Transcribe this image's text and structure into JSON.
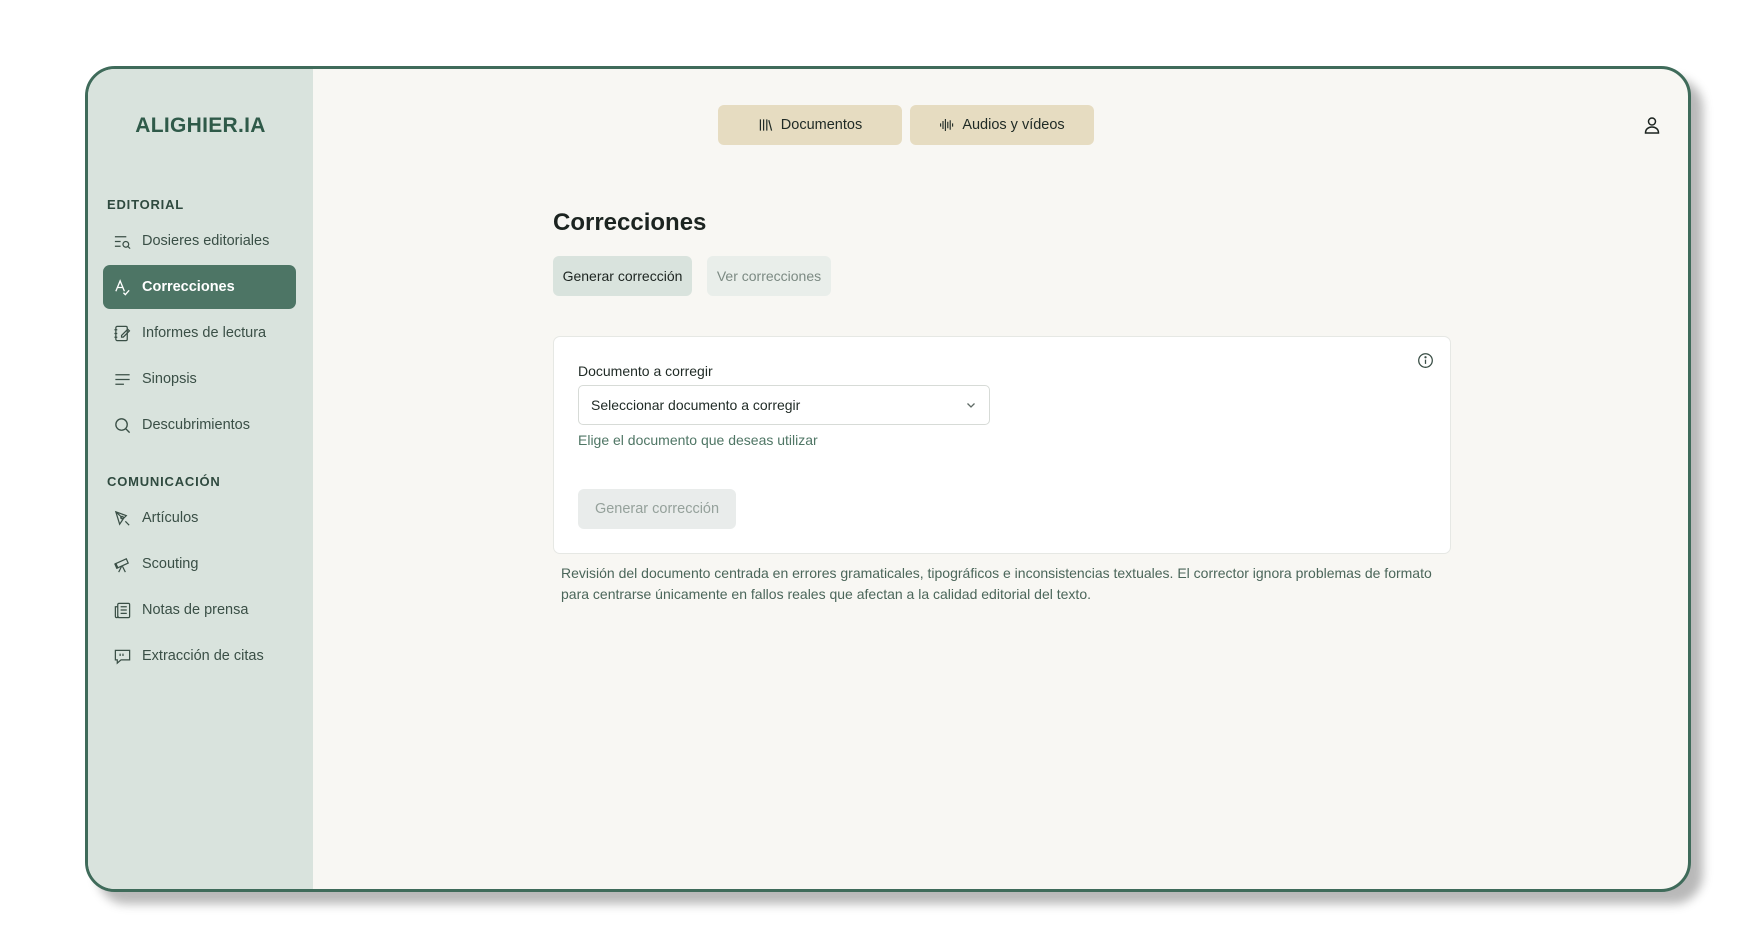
{
  "app": {
    "logo": "ALIGHIER.IA"
  },
  "sidebar": {
    "sections": [
      {
        "title": "EDITORIAL"
      },
      {
        "title": "COMUNICACIÓN"
      }
    ],
    "items": [
      {
        "label": "Dosieres editoriales",
        "icon": "list-search-icon"
      },
      {
        "label": "Correcciones",
        "icon": "spellcheck-icon",
        "active": true
      },
      {
        "label": "Informes de lectura",
        "icon": "notebook-edit-icon"
      },
      {
        "label": "Sinopsis",
        "icon": "align-left-icon"
      },
      {
        "label": "Descubrimientos",
        "icon": "search-icon"
      },
      {
        "label": "Artículos",
        "icon": "pen-tool-icon"
      },
      {
        "label": "Scouting",
        "icon": "telescope-icon"
      },
      {
        "label": "Notas de prensa",
        "icon": "newspaper-icon"
      },
      {
        "label": "Extracción de citas",
        "icon": "quote-message-icon"
      }
    ]
  },
  "topbar": {
    "tabs": [
      {
        "label": "Documentos",
        "icon": "library-icon"
      },
      {
        "label": "Audios y vídeos",
        "icon": "audio-wave-icon"
      }
    ],
    "user_icon": "user-icon"
  },
  "page": {
    "title": "Correcciones",
    "tabs": [
      {
        "label": "Generar corrección",
        "active": true
      },
      {
        "label": "Ver correcciones",
        "active": false
      }
    ],
    "form": {
      "field_label": "Documento a corregir",
      "select_value": "Seleccionar documento a corregir",
      "hint": "Elige el documento que deseas utilizar",
      "submit_label": "Generar corrección"
    },
    "description": "Revisión del documento centrada en errores gramaticales, tipográficos e inconsistencias textuales. El corrector ignora problemas de formato para centrarse únicamente en fallos reales que afectan a la calidad editorial del texto."
  },
  "colors": {
    "sidebar_bg": "#d9e3dd",
    "active_item": "#4d7565",
    "top_tab_bg": "#e6dcc1",
    "border_accent": "#3f6b5a"
  }
}
